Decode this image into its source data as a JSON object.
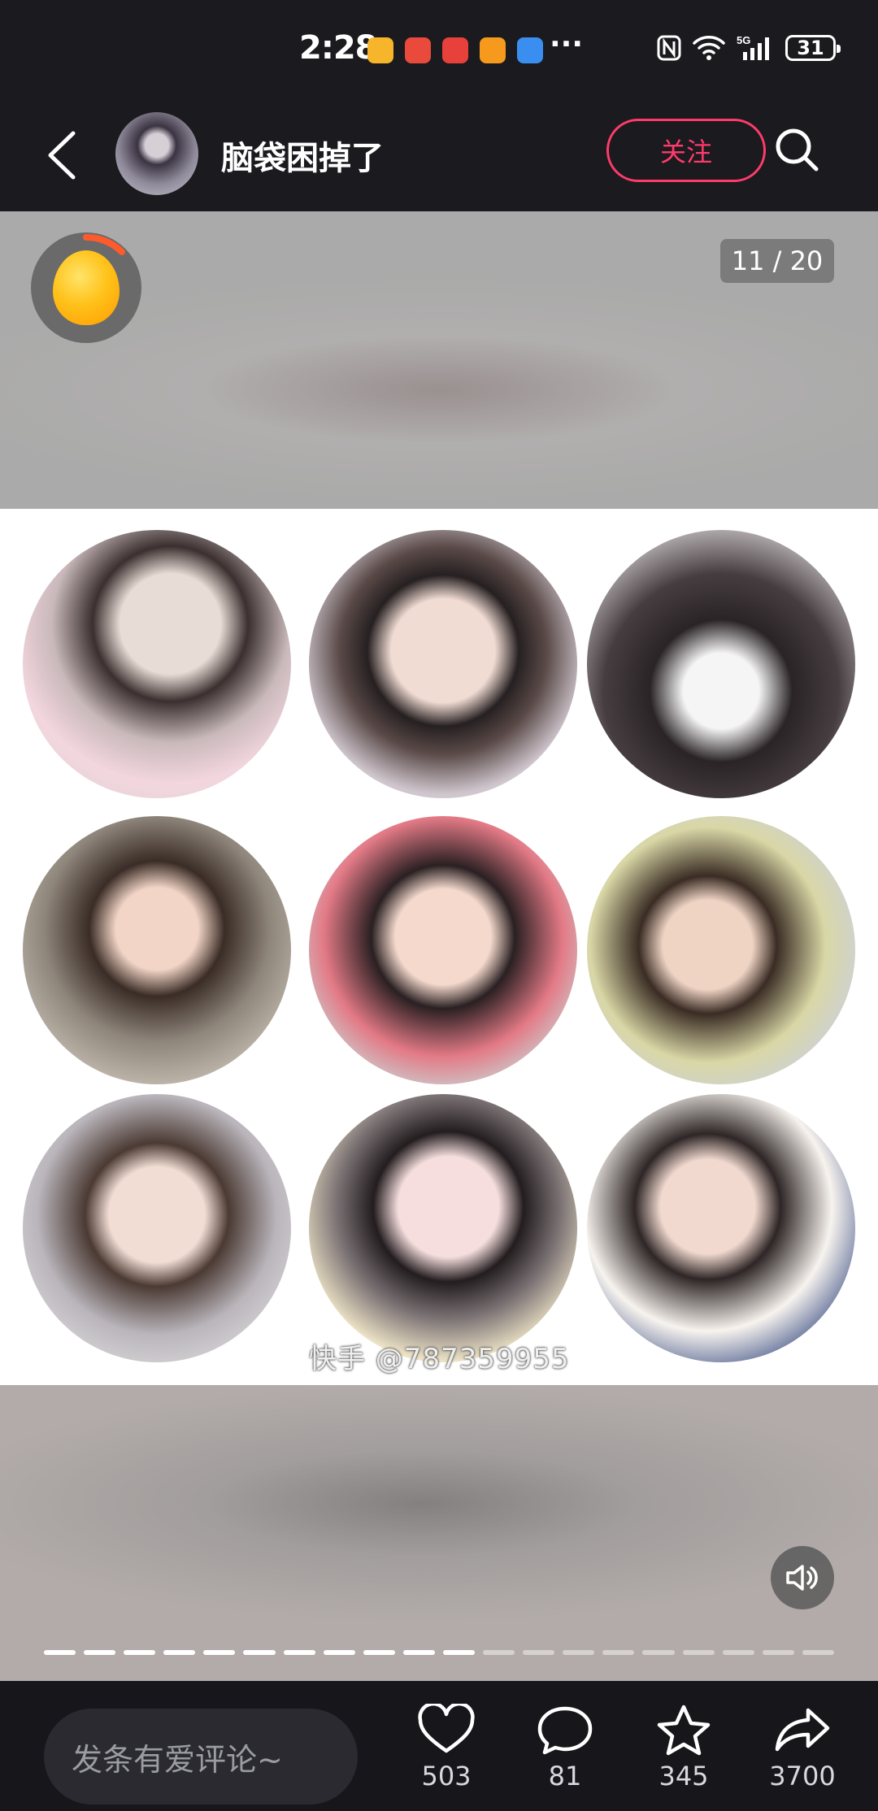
{
  "status_bar": {
    "time": "2:28",
    "battery": "31"
  },
  "header": {
    "username": "脑袋困掉了",
    "follow_label": "关注"
  },
  "media": {
    "counter": "11 / 20",
    "watermark": "快手 @787359955",
    "progress": {
      "total": 20,
      "current": 11
    }
  },
  "actions": {
    "comment_placeholder": "发条有爱评论~",
    "likes": "503",
    "comments": "81",
    "favorites": "345",
    "shares": "3700"
  },
  "icons": [
    "back-icon",
    "search-icon",
    "gold-egg-icon",
    "volume-icon",
    "heart-icon",
    "comment-icon",
    "star-icon",
    "share-icon"
  ],
  "colors": {
    "accent": "#ff3b6a",
    "background": "#16161b"
  }
}
